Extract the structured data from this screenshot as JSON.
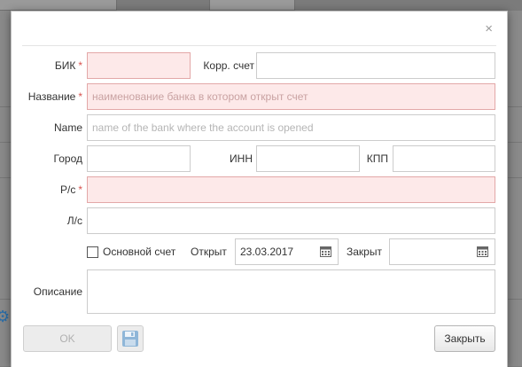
{
  "dialog": {
    "close_glyph": "×",
    "fields": {
      "bik": {
        "label": "БИК",
        "required_mark": "*",
        "value": ""
      },
      "korr": {
        "label": "Корр. счет",
        "value": ""
      },
      "name_ru": {
        "label": "Название",
        "required_mark": "*",
        "placeholder": "наименование банка в котором открыт счет",
        "value": ""
      },
      "name_en": {
        "label": "Name",
        "placeholder": "name of the bank where the account is opened",
        "value": ""
      },
      "city": {
        "label": "Город",
        "value": ""
      },
      "inn": {
        "label": "ИНН",
        "value": ""
      },
      "kpp": {
        "label": "КПП",
        "value": ""
      },
      "rs": {
        "label": "Р/с",
        "required_mark": "*",
        "value": ""
      },
      "ls": {
        "label": "Л/с",
        "value": ""
      },
      "main_account": {
        "label": "Основной счет",
        "checked": false
      },
      "opened": {
        "label": "Открыт",
        "value": "23.03.2017",
        "icon": "calendar-icon"
      },
      "closed": {
        "label": "Закрыт",
        "value": "",
        "icon": "calendar-icon"
      },
      "description": {
        "label": "Описание",
        "value": ""
      }
    },
    "buttons": {
      "ok_label": "OK",
      "ok_disabled": true,
      "save_icon": "floppy-disk-icon",
      "close_label": "Закрыть"
    }
  },
  "colors": {
    "required_mark": "#d9534f",
    "error_field_bg": "#fde9e9",
    "error_field_border": "#e3a8a8"
  }
}
